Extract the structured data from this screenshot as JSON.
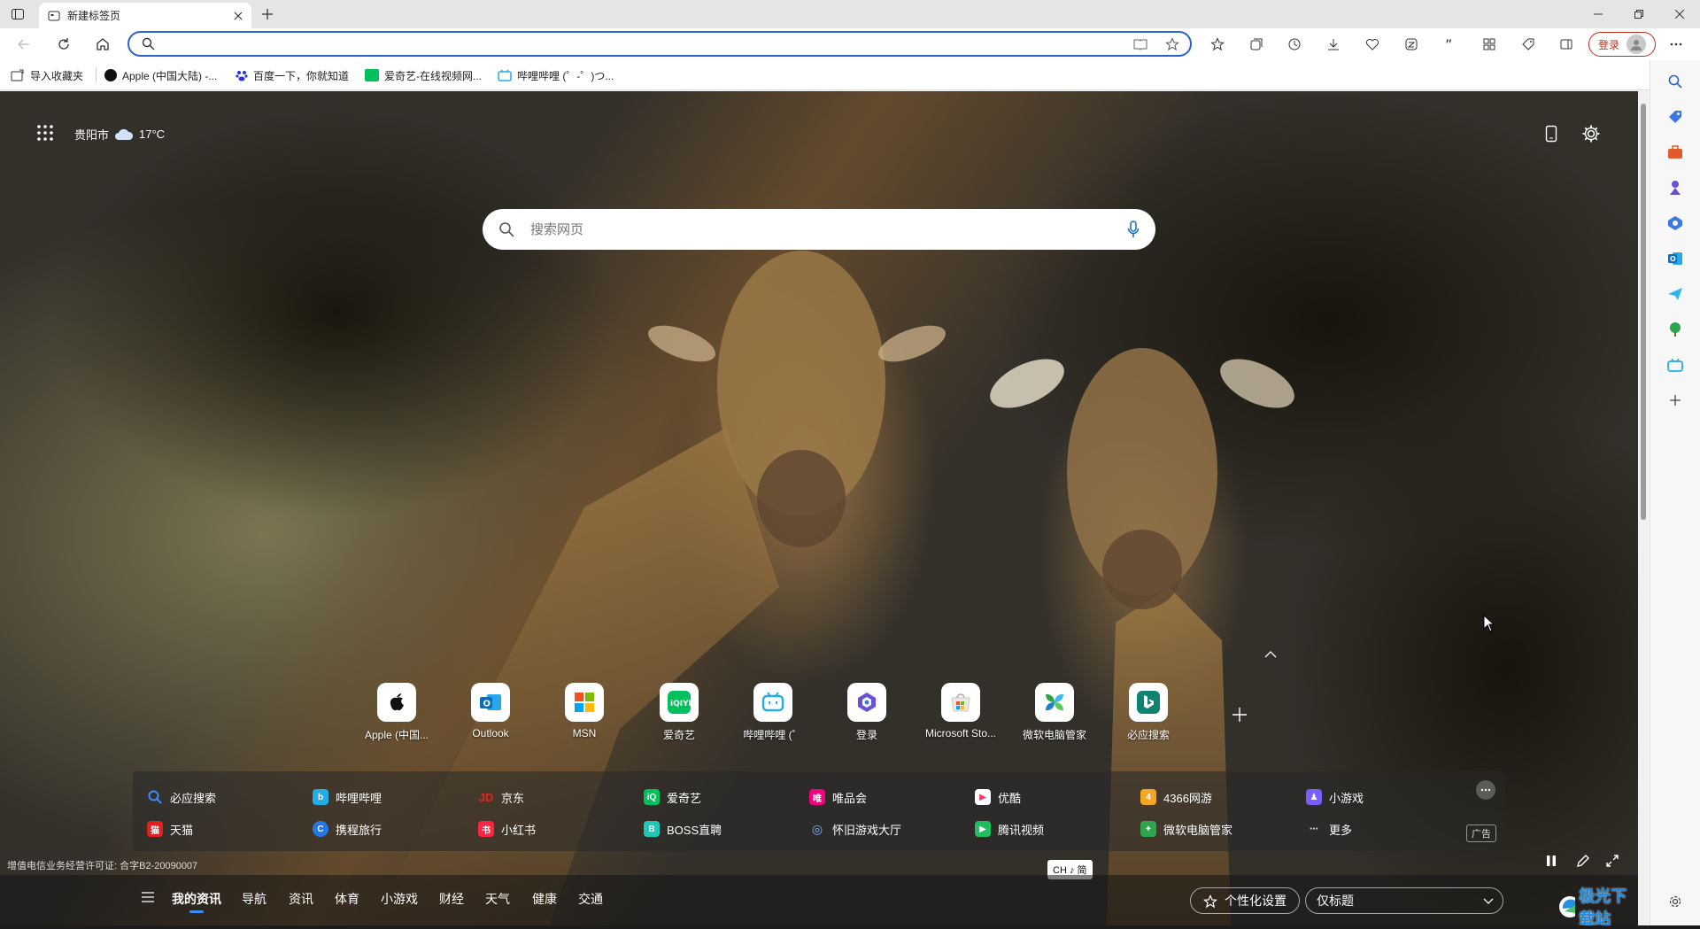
{
  "tab": {
    "title": "新建标签页"
  },
  "address": {
    "placeholder": "",
    "value": ""
  },
  "toolbar": {
    "login_label": "登录"
  },
  "bookmarks": [
    {
      "label": "导入收藏夹"
    },
    {
      "label": "Apple (中国大陆) -..."
    },
    {
      "label": "百度一下，你就知道"
    },
    {
      "label": "爱奇艺-在线视频网..."
    },
    {
      "label": "哔哩哔哩 (゜-゜)つ..."
    }
  ],
  "weather": {
    "city": "贵阳市",
    "temp": "17°C"
  },
  "search": {
    "placeholder": "搜索网页"
  },
  "quick_links": [
    {
      "label": "Apple (中国...",
      "color": "#111111"
    },
    {
      "label": "Outlook",
      "color": "#0f6cbd"
    },
    {
      "label": "MSN",
      "color": "#e74c3c"
    },
    {
      "label": "爱奇艺",
      "color": "#00c15d"
    },
    {
      "label": "哔哩哔哩 (゜",
      "color": "#23ade5"
    },
    {
      "label": "登录",
      "color": "#6b4fd8"
    },
    {
      "label": "Microsoft Sto...",
      "color": "#e0a020"
    },
    {
      "label": "微软电脑管家",
      "color": "#2ea44f"
    },
    {
      "label": "必应搜索",
      "color": "#108272"
    }
  ],
  "links": [
    {
      "label": "必应搜索",
      "icon": "B",
      "color": "#2b6fd6"
    },
    {
      "label": "哔哩哔哩",
      "icon": "b",
      "color": "#23ade5"
    },
    {
      "label": "京东",
      "icon": "JD",
      "color": "#e1251b"
    },
    {
      "label": "爱奇艺",
      "icon": "iQ",
      "color": "#00c15d"
    },
    {
      "label": "唯品会",
      "icon": "唯",
      "color": "#f10180"
    },
    {
      "label": "优酷",
      "icon": "▶",
      "color": "#ff3366"
    },
    {
      "label": "4366网游",
      "icon": "4",
      "color": "#f5a623"
    },
    {
      "label": "小游戏",
      "icon": "♟",
      "color": "#7b5cff"
    },
    {
      "label": "天猫",
      "icon": "猫",
      "color": "#e02020"
    },
    {
      "label": "携程旅行",
      "icon": "C",
      "color": "#2577e3"
    },
    {
      "label": "小红书",
      "icon": "书",
      "color": "#ff2442"
    },
    {
      "label": "BOSS直聘",
      "icon": "B",
      "color": "#20c6b6"
    },
    {
      "label": "怀旧游戏大厅",
      "icon": "◎",
      "color": "#2a7fd4"
    },
    {
      "label": "腾讯视频",
      "icon": "▶",
      "color": "#1fbf5f"
    },
    {
      "label": "微软电脑管家",
      "icon": "✦",
      "color": "#2ea44f"
    },
    {
      "label": "更多",
      "icon": "⋯",
      "color": "#666666"
    }
  ],
  "ad_label": "广告",
  "license": "增值电信业务经营许可证: 合字B2-20090007",
  "ime": "CH ♪ 简",
  "nav": [
    "我的资讯",
    "导航",
    "资讯",
    "体育",
    "小游戏",
    "财经",
    "天气",
    "健康",
    "交通"
  ],
  "personalize": "个性化设置",
  "layout_select": "仅标题",
  "watermark": "极光下载站"
}
